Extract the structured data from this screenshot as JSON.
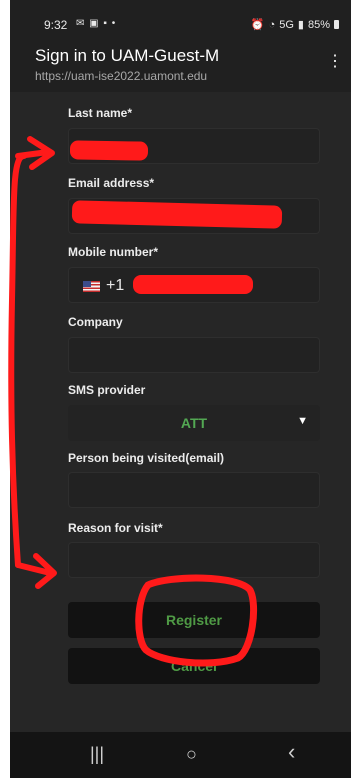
{
  "status_bar": {
    "time": "9:32",
    "left_icons": "✉ ▣ ▪ •",
    "network": "5G",
    "battery": "85%"
  },
  "app_bar": {
    "title": "Sign in to UAM-Guest-M",
    "url": "https://uam-ise2022.uamont.edu",
    "menu_icon": "more-vert-icon"
  },
  "form": {
    "last_name": {
      "label": "Last name*",
      "value": ""
    },
    "email": {
      "label": "Email address*",
      "value": ""
    },
    "mobile": {
      "label": "Mobile number*",
      "country_code": "+1",
      "value": ""
    },
    "company": {
      "label": "Company",
      "value": ""
    },
    "sms_provider": {
      "label": "SMS provider",
      "selected": "ATT"
    },
    "person_visited": {
      "label": "Person being visited(email)",
      "value": ""
    },
    "reason": {
      "label": "Reason for visit*",
      "value": ""
    }
  },
  "buttons": {
    "register": "Register",
    "cancel": "Cancel"
  },
  "nav": {
    "recents": "|||",
    "home": "○",
    "back": "‹"
  },
  "colors": {
    "accent_green": "#53a853",
    "annotation_red": "#ff1a1a",
    "background": "#262626"
  }
}
